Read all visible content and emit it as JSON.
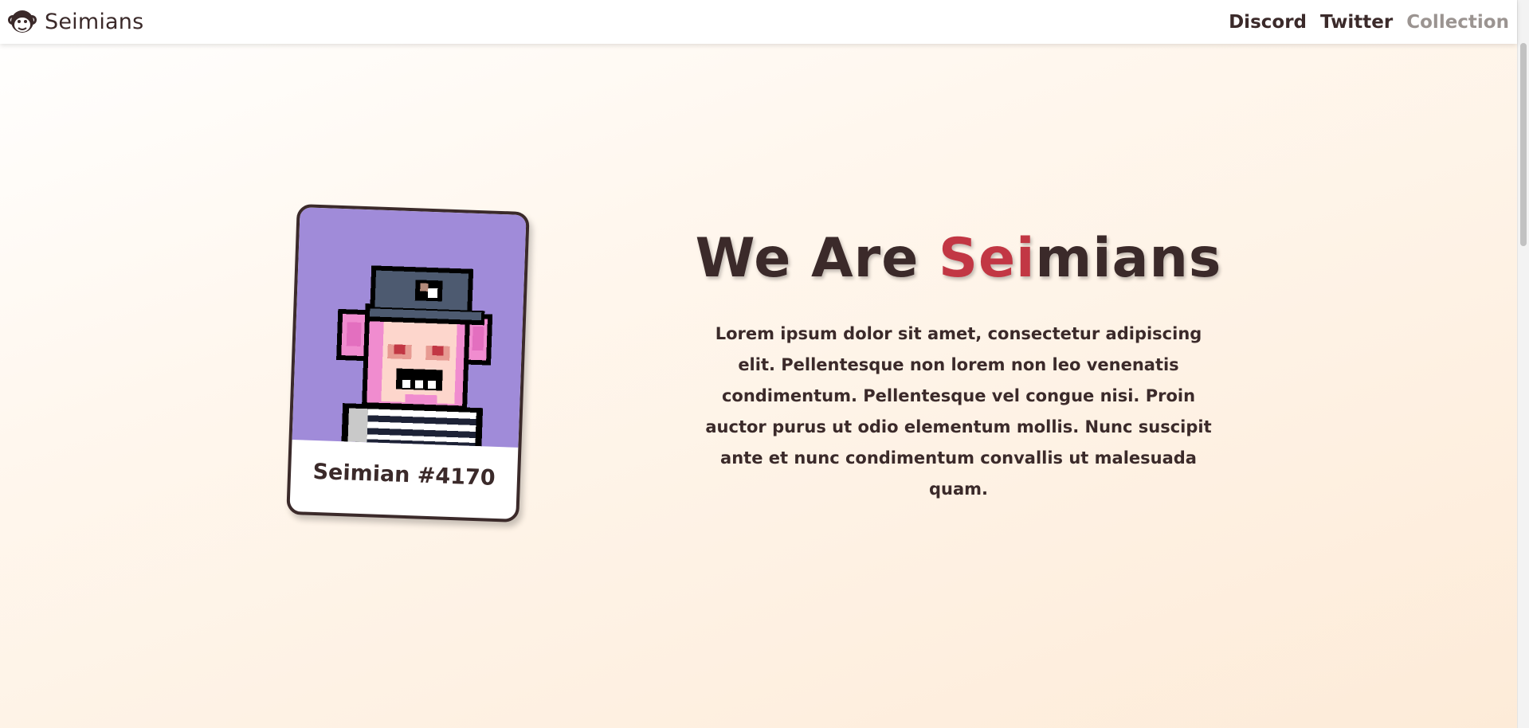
{
  "header": {
    "brand_name": "Seimians",
    "logo_icon": "monkey-head-icon",
    "nav": [
      {
        "label": "Discord"
      },
      {
        "label": "Twitter"
      },
      {
        "label": "Collection"
      }
    ]
  },
  "card": {
    "label": "Seimian #4170",
    "art_background": "#a08bd9"
  },
  "hero": {
    "title_part1": "We Are ",
    "title_accent": "Sei",
    "title_part2": "mians",
    "accent_color": "#c23744",
    "description": "Lorem ipsum dolor sit amet, consectetur adipiscing elit. Pellentesque non lorem non leo venenatis condimentum. Pellentesque vel congue nisi. Proin auctor purus ut odio elementum mollis. Nunc suscipit ante et nunc condimentum convallis ut malesuada quam."
  }
}
